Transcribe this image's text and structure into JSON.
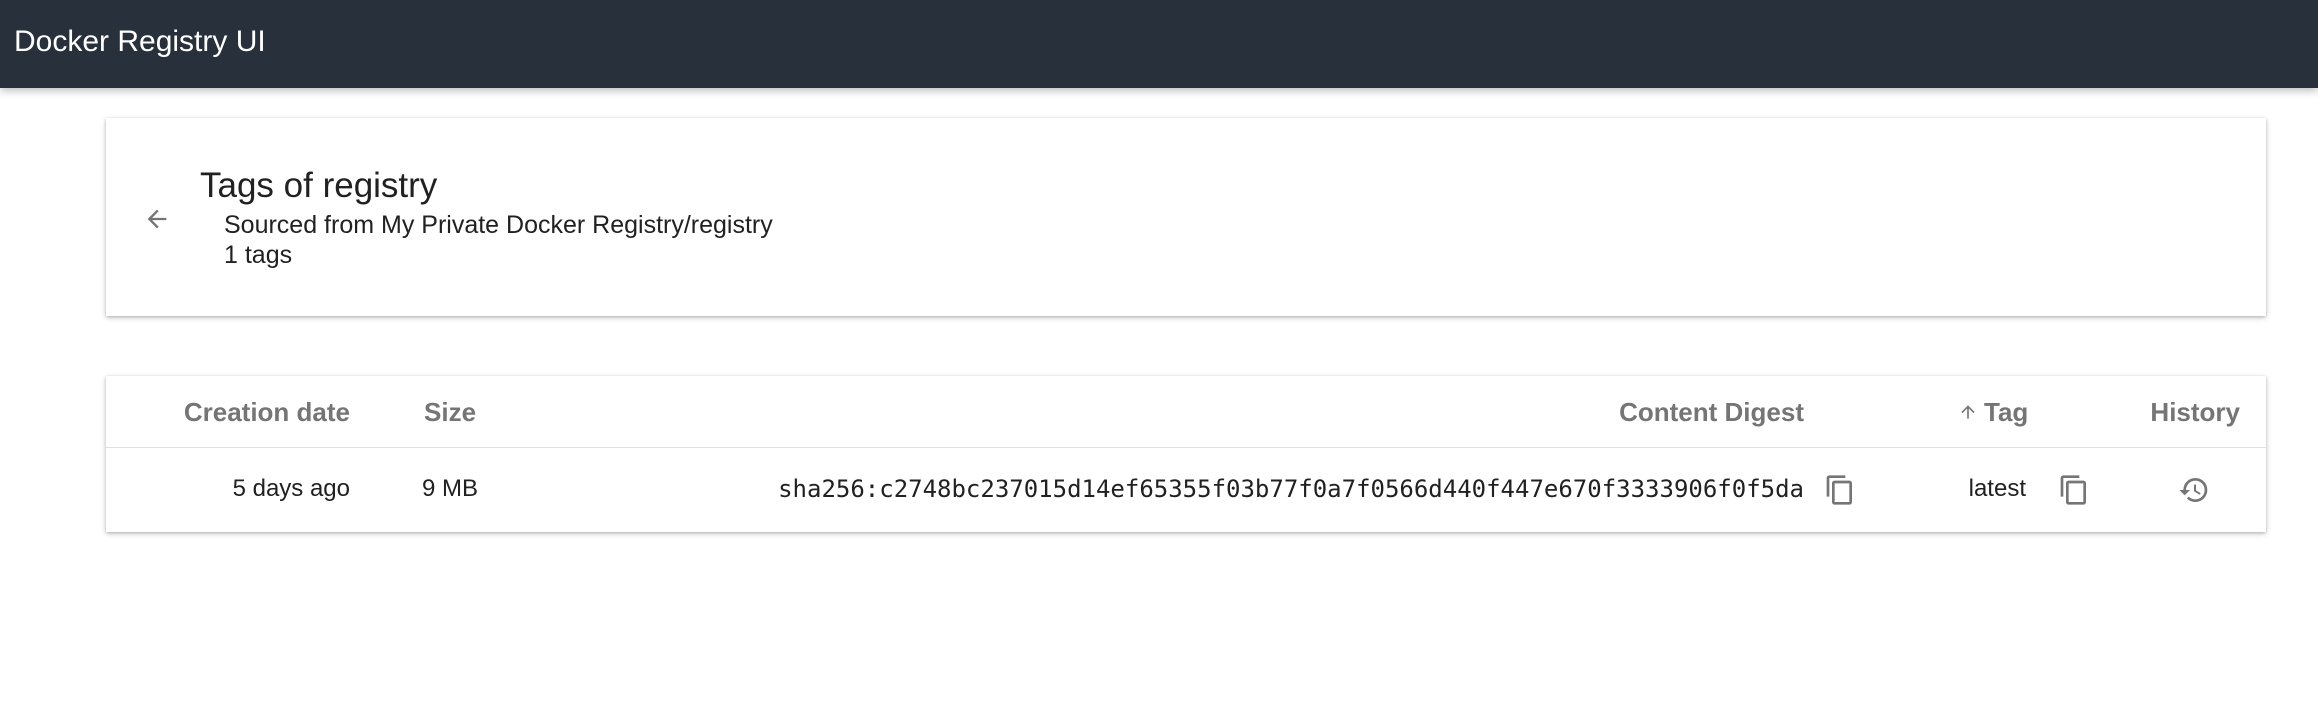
{
  "app": {
    "title": "Docker Registry UI"
  },
  "header": {
    "title": "Tags of registry",
    "subtitle": "Sourced from My Private Docker Registry/registry",
    "count": "1 tags"
  },
  "table": {
    "columns": {
      "creation_date": "Creation date",
      "size": "Size",
      "content_digest": "Content Digest",
      "tag": "Tag",
      "history": "History"
    },
    "sort": {
      "column": "tag",
      "direction": "ascending"
    },
    "rows": [
      {
        "creation_date": "5 days ago",
        "size": "9 MB",
        "content_digest": "sha256:c2748bc237015d14ef65355f03b77f0a7f0566d440f447e670f3333906f0f5da",
        "tag": "latest"
      }
    ]
  },
  "icons": {
    "back": "arrow-back-icon",
    "sort": "arrow-up-icon",
    "copy": "copy-icon",
    "history": "history-icon"
  },
  "colors": {
    "topbar": "#28313b",
    "header_text": "#757575",
    "icon": "#757575"
  }
}
